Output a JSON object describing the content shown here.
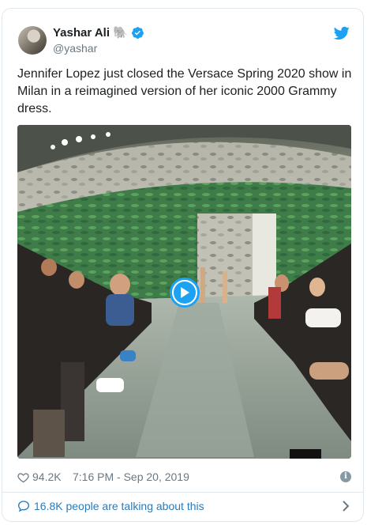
{
  "tweet": {
    "author_name": "Yashar Ali",
    "author_emoji": "🐘",
    "handle": "@yashar",
    "text": "Jennifer Lopez just closed the Versace Spring 2020 show in Milan in a reimagined version of her iconic 2000 Grammy dress.",
    "likes": "94.2K",
    "timestamp": "7:16 PM - Sep 20, 2019",
    "conversation": "16.8K people are talking about this"
  },
  "icons": {
    "verified": "verified-badge-icon",
    "brand": "twitter-bird-icon",
    "like": "heart-icon",
    "info": "info-icon",
    "conversation": "speech-bubble-icon",
    "chevron": "chevron-right-icon",
    "play": "play-icon"
  },
  "colors": {
    "accent": "#1da1f2",
    "link": "#2b7bb9",
    "muted": "#697882",
    "border": "#e1e8ed"
  }
}
